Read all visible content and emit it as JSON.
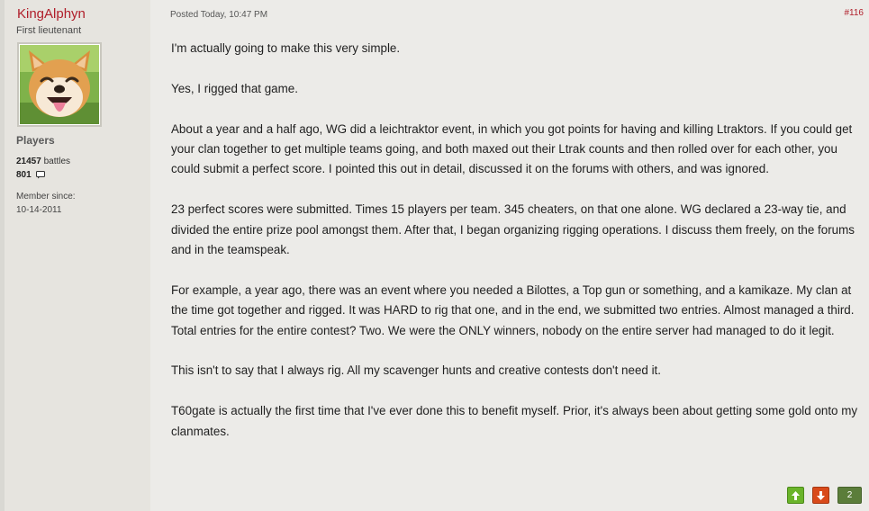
{
  "author": {
    "username": "KingAlphyn",
    "rank": "First lieutenant",
    "avatar_icon": "smiling-dog-avatar",
    "group": "Players",
    "battles_count": "21457",
    "battles_label": "battles",
    "posts_count": "801",
    "posts_icon": "speech-bubble-icon",
    "member_since_label": "Member since:",
    "member_since_date": "10-14-2011"
  },
  "post": {
    "posted": "Posted Today, 10:47 PM",
    "number": "#116",
    "paragraphs": [
      "I'm actually going to make this very simple.",
      "Yes, I rigged that game.",
      "About a year and a half ago, WG did a leichtraktor event, in which you got points for having and killing Ltraktors. If you could get  your clan together to get multiple teams going, and both maxed out their Ltrak counts and then rolled over for each other, you could submit a perfect score. I pointed this out in detail, discussed it on the forums with others, and was ignored.",
      "23 perfect scores were submitted. Times 15 players per team. 345 cheaters, on that one alone. WG declared a 23-way tie, and divided the entire prize pool amongst them. After that, I began organizing rigging operations. I discuss them freely, on the forums and in the teamspeak.",
      "For example, a year ago, there was an event where you needed a Bilottes, a Top gun or something, and a kamikaze. My clan at the time got together and rigged. It was HARD to rig that one, and in the end, we submitted two entries. Almost managed a third. Total entries for the entire contest? Two. We were the ONLY winners, nobody on the entire server had managed to do it legit.",
      "This isn't to say that I always rig. All my scavenger hunts and creative contests don't need it.",
      "T60gate is actually the first time that I've ever done this to benefit myself. Prior, it's always been about getting some gold onto my clanmates."
    ]
  },
  "votes": {
    "up_icon": "arrow-up-icon",
    "down_icon": "arrow-down-icon",
    "count": "2",
    "up_color": "#6ab42a",
    "down_color": "#d94a1a",
    "count_color": "#5b7d3a"
  },
  "colors": {
    "username": "#b01e2a",
    "background": "#ecebe8"
  }
}
